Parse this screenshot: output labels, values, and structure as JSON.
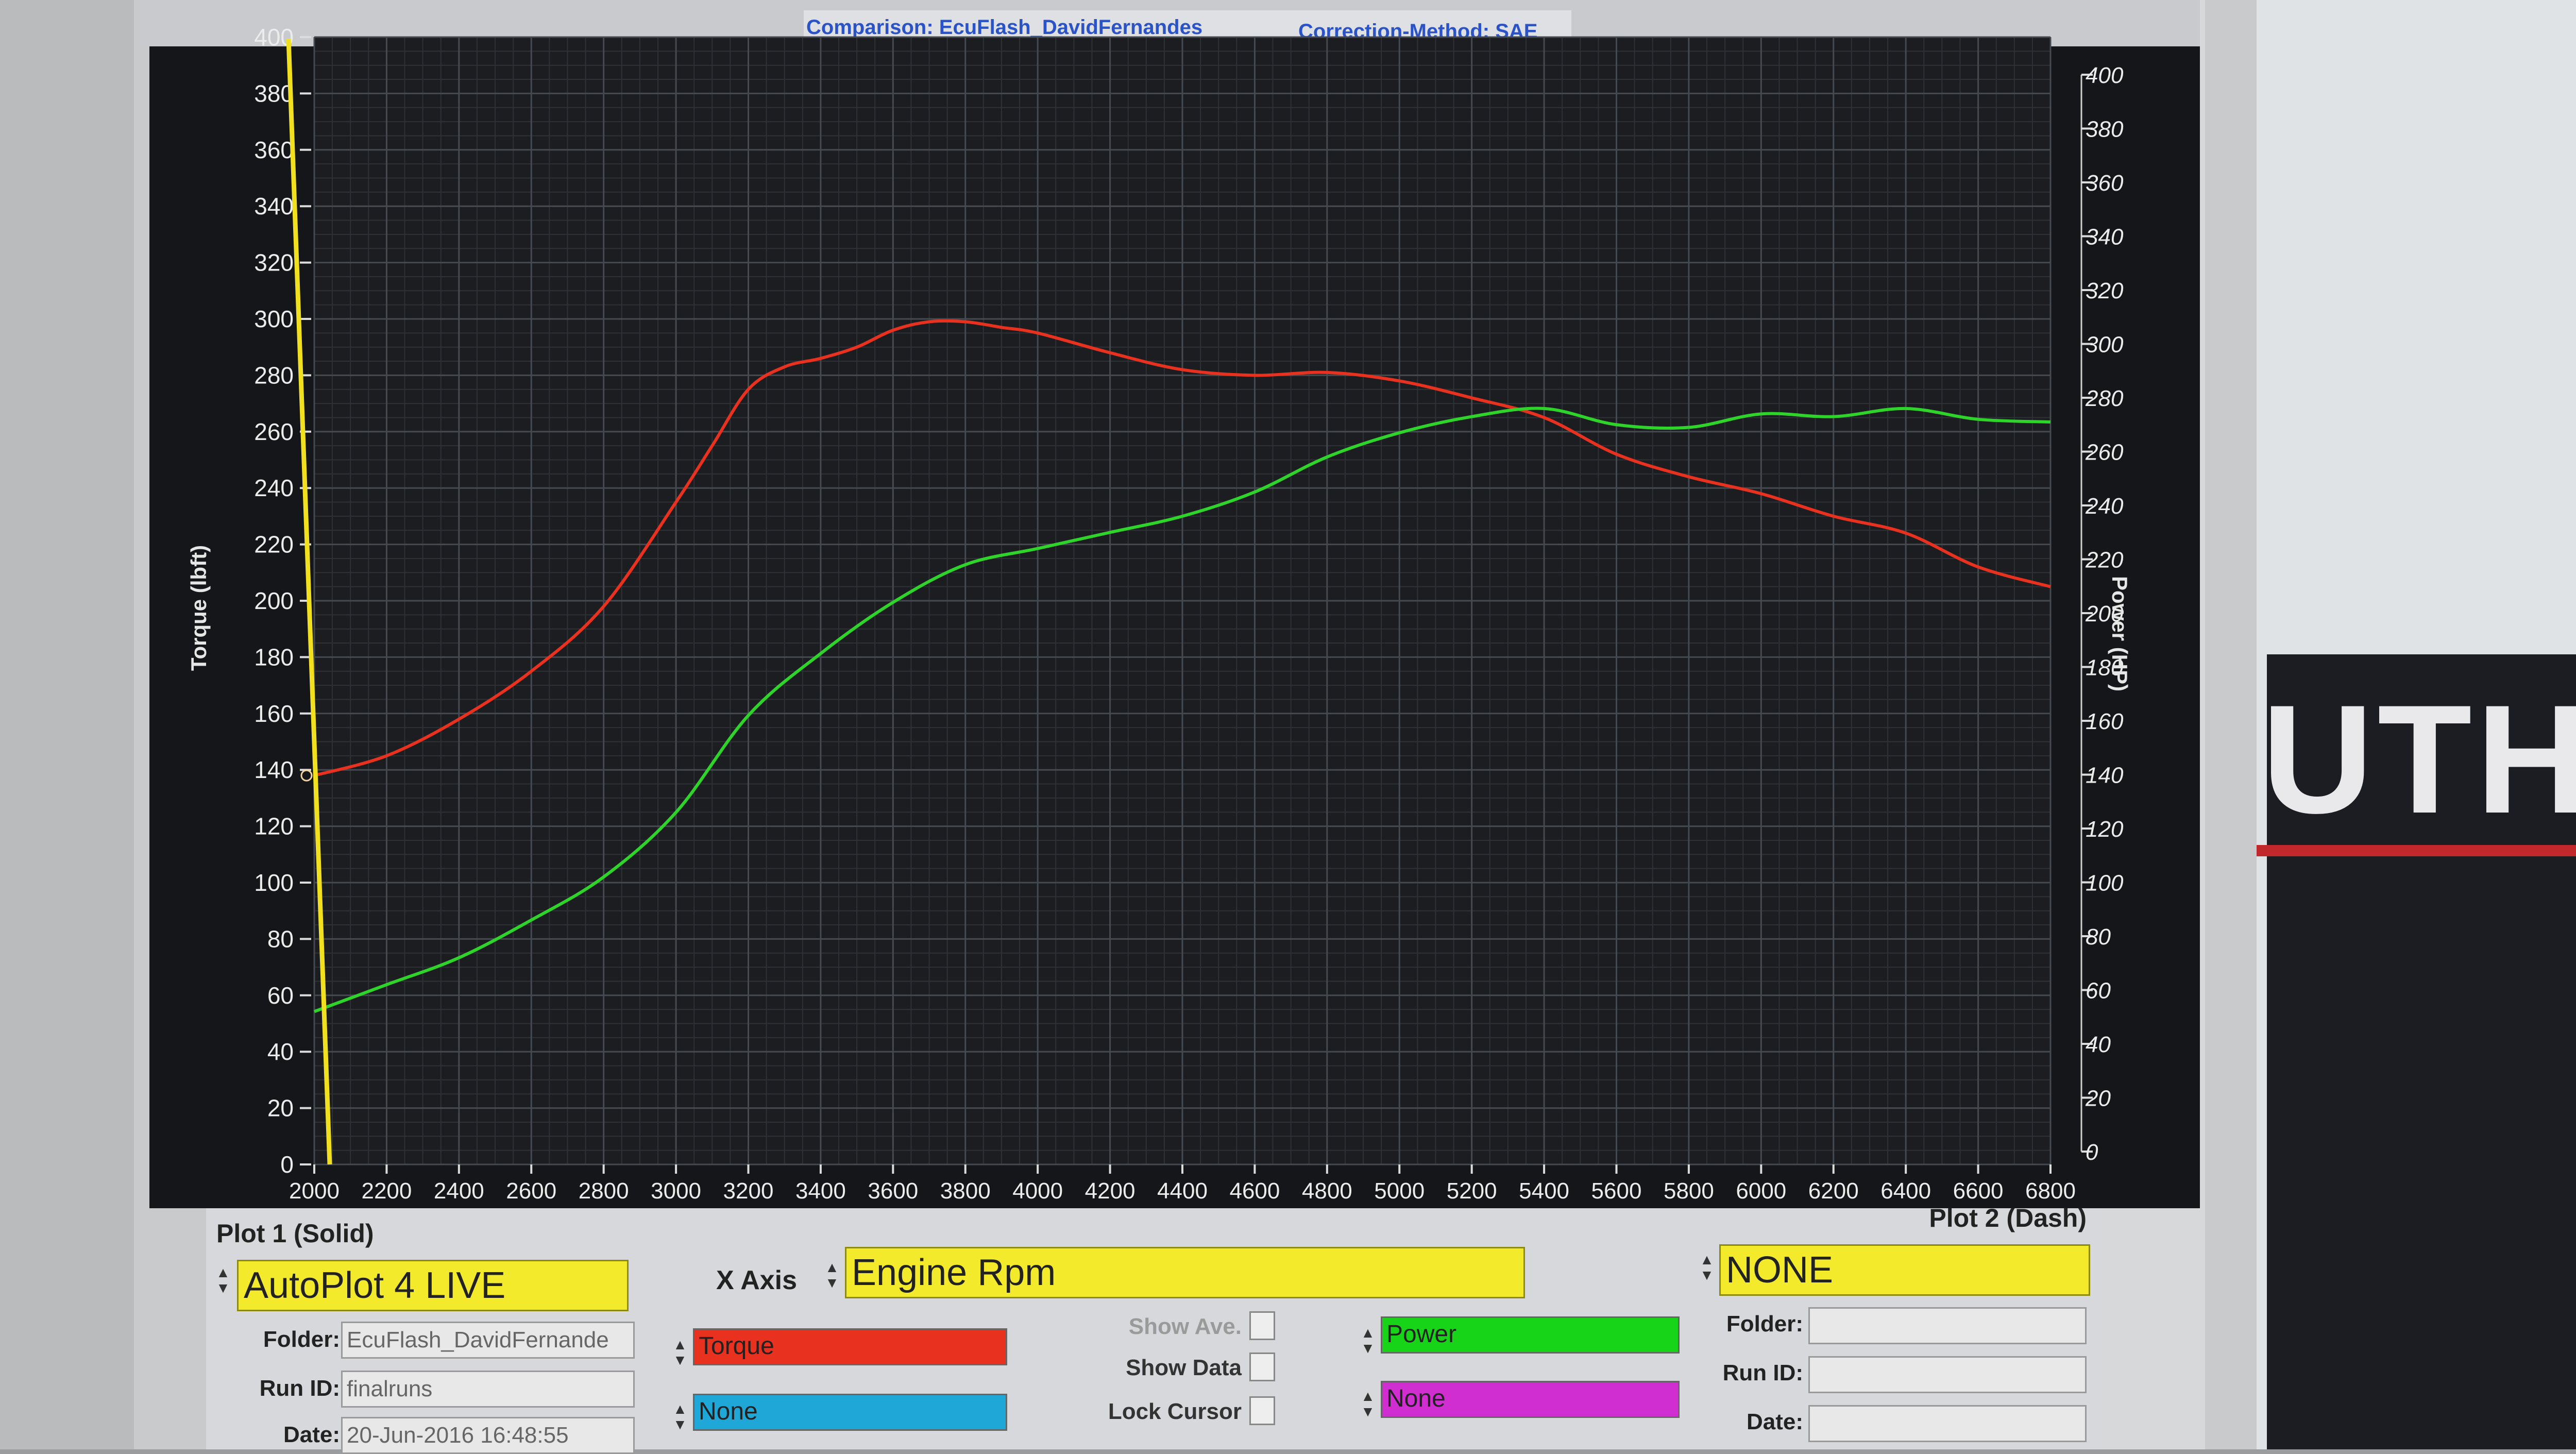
{
  "header": {
    "comparison": "Comparison: EcuFlash_DavidFernandes",
    "correction": "Correction-Method: SAE"
  },
  "chart_data": {
    "type": "line",
    "xlabel": "",
    "x_ticks": [
      "2000",
      "2200",
      "2400",
      "2600",
      "2800",
      "3000",
      "3200",
      "3400",
      "3600",
      "3800",
      "4000",
      "4200",
      "4400",
      "4600",
      "4800",
      "5000",
      "5200",
      "5400",
      "5600",
      "5800",
      "6000",
      "6200",
      "6400",
      "6600",
      "6800"
    ],
    "xlim": [
      2000,
      6800
    ],
    "left_axis": {
      "label": "Torque (lbft)",
      "ylim": [
        0,
        400
      ],
      "ticks": [
        "0",
        "20",
        "40",
        "60",
        "80",
        "100",
        "120",
        "140",
        "160",
        "180",
        "200",
        "220",
        "240",
        "260",
        "280",
        "300",
        "320",
        "340",
        "360",
        "380",
        "400"
      ]
    },
    "right_axis": {
      "label": "Power (HP)",
      "ylim": [
        0,
        400
      ],
      "ticks": [
        "0",
        "20",
        "40",
        "60",
        "80",
        "100",
        "120",
        "140",
        "160",
        "180",
        "200",
        "220",
        "240",
        "260",
        "280",
        "300",
        "320",
        "340",
        "360",
        "380",
        "400"
      ]
    },
    "grid": true,
    "series": [
      {
        "name": "Torque",
        "axis": "left",
        "color": "#e8311f",
        "x": [
          2000,
          2200,
          2400,
          2600,
          2800,
          3000,
          3100,
          3200,
          3300,
          3400,
          3500,
          3600,
          3700,
          3800,
          3900,
          4000,
          4200,
          4400,
          4600,
          4800,
          5000,
          5200,
          5400,
          5600,
          5800,
          6000,
          6200,
          6400,
          6600,
          6800
        ],
        "y": [
          138,
          145,
          158,
          175,
          198,
          235,
          255,
          275,
          283,
          286,
          290,
          296,
          299,
          299,
          297,
          295,
          288,
          282,
          280,
          281,
          278,
          272,
          265,
          252,
          244,
          238,
          230,
          224,
          212,
          205
        ]
      },
      {
        "name": "Power",
        "axis": "right",
        "color": "#2fd42a",
        "x": [
          2000,
          2200,
          2400,
          2600,
          2800,
          3000,
          3200,
          3400,
          3600,
          3800,
          4000,
          4200,
          4400,
          4600,
          4800,
          5000,
          5200,
          5400,
          5600,
          5800,
          6000,
          6200,
          6400,
          6600,
          6800
        ],
        "y": [
          52,
          62,
          72,
          86,
          102,
          126,
          162,
          185,
          204,
          218,
          224,
          230,
          236,
          245,
          258,
          267,
          273,
          276,
          270,
          269,
          274,
          273,
          276,
          272,
          271
        ]
      }
    ],
    "cursor": {
      "x": 2000,
      "color": "#f0e020"
    }
  },
  "panel": {
    "plot1_title": "Plot 1 (Solid)",
    "plot1_source": "AutoPlot 4 LIVE",
    "folder_label": "Folder:",
    "folder_value": "EcuFlash_DavidFernande",
    "runid_label": "Run ID:",
    "runid_value": "finalruns",
    "date_label": "Date:",
    "date_value": "20-Jun-2016 16:48:55",
    "xaxis_label": "X Axis",
    "xaxis_value": "Engine Rpm",
    "torque_chip": "Torque",
    "none_chip_left": "None",
    "show_ave": "Show Ave.",
    "show_data": "Show Data",
    "lock_cursor": "Lock Cursor",
    "power_chip": "Power",
    "none_chip_right": "None",
    "plot2_title": "Plot 2 (Dash)",
    "plot2_source": "NONE",
    "folder2_label": "Folder:",
    "runid2_label": "Run ID:",
    "date2_label": "Date:",
    "colors": {
      "torque": "#e8311f",
      "none_left": "#1fa7d8",
      "power": "#18d418",
      "none_right": "#d12ed1",
      "selector": "#f2ea2a"
    }
  },
  "background": {
    "wall_text": "UTH"
  }
}
